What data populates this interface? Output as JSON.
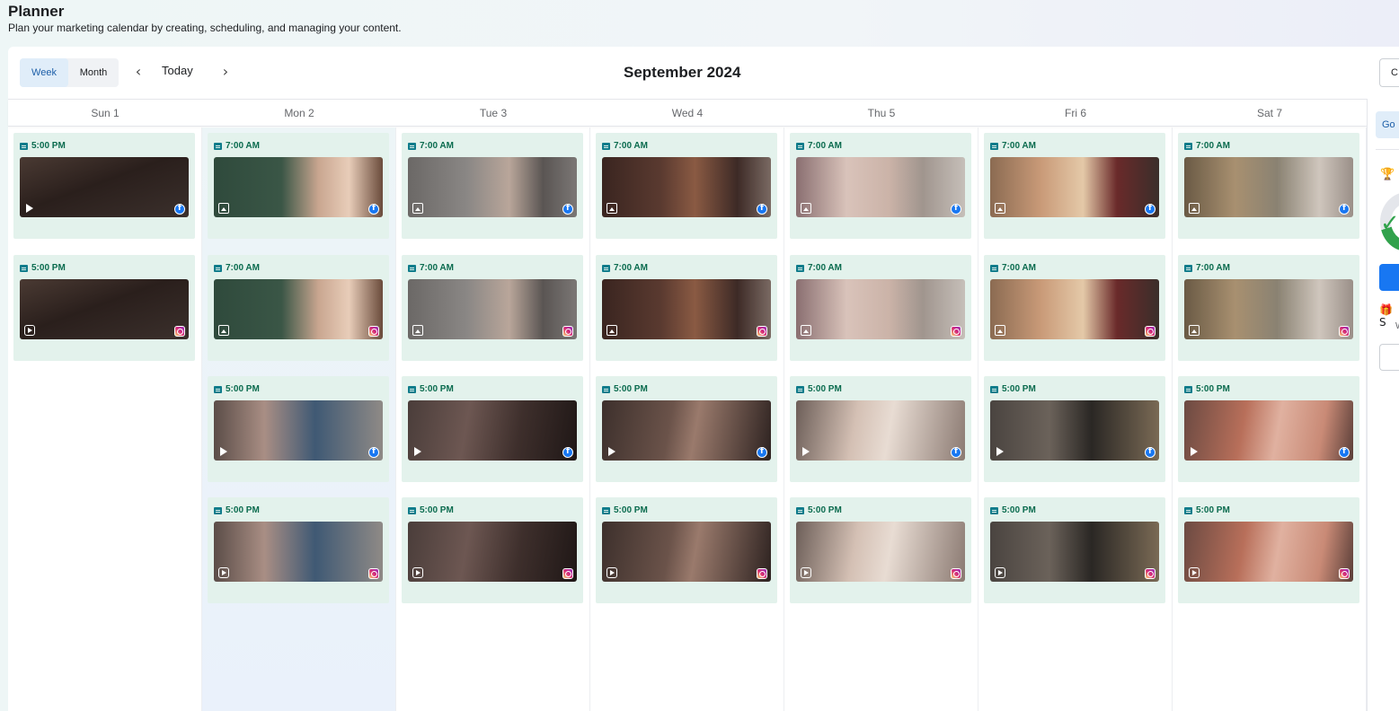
{
  "header": {
    "title": "Planner",
    "subtitle": "Plan your marketing calendar by creating, scheduling, and managing your content."
  },
  "toolbar": {
    "view_week": "Week",
    "view_month": "Month",
    "active_view": "Week",
    "today_label": "Today",
    "month_title": "September 2024",
    "right_button_partial": "C"
  },
  "sidebar": {
    "tab_partial": "Go",
    "gift_partial": "S",
    "w_partial": "W"
  },
  "colors": {
    "card_bg": "#e3f2ec",
    "time_text": "#0a6b4e",
    "facebook": "#1877f2",
    "accent_blue": "#1d5fa8"
  },
  "days": [
    {
      "label": "Sun 1",
      "today": false,
      "posts": [
        {
          "time": "5:00 PM",
          "media": "video",
          "platform": "facebook",
          "thumb": "dark-hair-closeup"
        },
        {
          "time": "5:00 PM",
          "media": "reel",
          "platform": "instagram",
          "thumb": "dark-hair-closeup"
        }
      ]
    },
    {
      "label": "Mon 2",
      "today": true,
      "posts": [
        {
          "time": "7:00 AM",
          "media": "image",
          "platform": "facebook",
          "thumb": "green-spa-50-off"
        },
        {
          "time": "7:00 AM",
          "media": "image",
          "platform": "instagram",
          "thumb": "green-spa-50-off"
        },
        {
          "time": "5:00 PM",
          "media": "video",
          "platform": "facebook",
          "thumb": "neck-massage"
        },
        {
          "time": "5:00 PM",
          "media": "reel",
          "platform": "instagram",
          "thumb": "neck-massage"
        }
      ]
    },
    {
      "label": "Tue 3",
      "today": false,
      "posts": [
        {
          "time": "7:00 AM",
          "media": "image",
          "platform": "facebook",
          "thumb": "grey-spa-30-off"
        },
        {
          "time": "7:00 AM",
          "media": "image",
          "platform": "instagram",
          "thumb": "grey-spa-30-off"
        },
        {
          "time": "5:00 PM",
          "media": "video",
          "platform": "facebook",
          "thumb": "dark-massage"
        },
        {
          "time": "5:00 PM",
          "media": "reel",
          "platform": "instagram",
          "thumb": "dark-massage"
        }
      ]
    },
    {
      "label": "Wed 4",
      "today": false,
      "posts": [
        {
          "time": "7:00 AM",
          "media": "image",
          "platform": "facebook",
          "thumb": "hair-trends"
        },
        {
          "time": "7:00 AM",
          "media": "image",
          "platform": "instagram",
          "thumb": "hair-trends"
        },
        {
          "time": "5:00 PM",
          "media": "video",
          "platform": "facebook",
          "thumb": "dark-face"
        },
        {
          "time": "5:00 PM",
          "media": "reel",
          "platform": "instagram",
          "thumb": "dark-face"
        }
      ]
    },
    {
      "label": "Thu 5",
      "today": false,
      "posts": [
        {
          "time": "7:00 AM",
          "media": "image",
          "platform": "facebook",
          "thumb": "facial-treatment"
        },
        {
          "time": "7:00 AM",
          "media": "image",
          "platform": "instagram",
          "thumb": "facial-treatment"
        },
        {
          "time": "5:00 PM",
          "media": "video",
          "platform": "facebook",
          "thumb": "face-mask-light"
        },
        {
          "time": "5:00 PM",
          "media": "reel",
          "platform": "instagram",
          "thumb": "face-mask-light"
        }
      ]
    },
    {
      "label": "Fri 6",
      "today": false,
      "posts": [
        {
          "time": "7:00 AM",
          "media": "image",
          "platform": "facebook",
          "thumb": "back-massage-orchid"
        },
        {
          "time": "7:00 AM",
          "media": "image",
          "platform": "instagram",
          "thumb": "back-massage-orchid"
        },
        {
          "time": "5:00 PM",
          "media": "video",
          "platform": "facebook",
          "thumb": "salon-interior"
        },
        {
          "time": "5:00 PM",
          "media": "reel",
          "platform": "instagram",
          "thumb": "salon-interior"
        }
      ]
    },
    {
      "label": "Sat 7",
      "today": false,
      "posts": [
        {
          "time": "7:00 AM",
          "media": "image",
          "platform": "facebook",
          "thumb": "spa-awards-slippers"
        },
        {
          "time": "7:00 AM",
          "media": "image",
          "platform": "instagram",
          "thumb": "spa-awards-slippers"
        },
        {
          "time": "5:00 PM",
          "media": "video",
          "platform": "facebook",
          "thumb": "face-mask-red"
        },
        {
          "time": "5:00 PM",
          "media": "reel",
          "platform": "instagram",
          "thumb": "face-mask-red"
        }
      ]
    }
  ]
}
